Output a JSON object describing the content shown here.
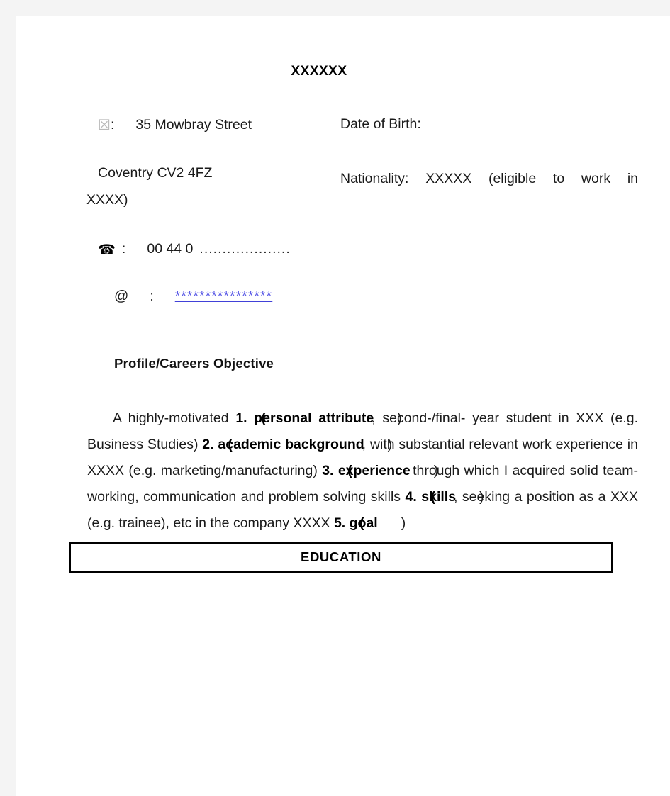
{
  "document": {
    "title": "XXXXXX",
    "page_background": "#ffffff",
    "canvas_background": "#f4f4f4"
  },
  "contact": {
    "address_icon": "envelope-icon",
    "address_icon_glyph": "☒",
    "address_separator": ":",
    "address_line1": "35 Mowbray Street",
    "address_line2": "Coventry CV2 4FZ",
    "phone_icon": "telephone-icon",
    "phone_icon_glyph": "☎",
    "phone_separator": ":",
    "phone_value": "00 44 0",
    "phone_dots": "....................",
    "email_icon": "at-icon",
    "email_icon_glyph": "@",
    "email_separator": ":",
    "email_value": "****************",
    "email_color": "#5a5ae6"
  },
  "personal": {
    "dob_label": "Date of Birth:",
    "nationality_line1": "Nationality:  XXXXX   (eligible  to  work  in",
    "nationality_line2": "XXXX)"
  },
  "profile": {
    "heading": "Profile/Careers Objective",
    "text_part1": "A highly-motivated ",
    "annotation1_open": "(",
    "annotation1": "1. personal attribute",
    "annotation1_close": ")",
    "text_part2": ", second-/final- year student in XXX (e.g. Business Studies) ",
    "annotation2_open": "(",
    "annotation2": "2. academic background",
    "annotation2_close": ")",
    "text_part3": ", with substantial relevant work experience in XXXX (e.g. marketing/manufacturing) ",
    "annotation3_open": "(",
    "annotation3": "3. experience",
    "annotation3_close": ")",
    "text_part4": " through which I acquired solid team-working, communication and problem solving skills ",
    "annotation4_open": "(",
    "annotation4": "4. skills",
    "annotation4_close": ")",
    "text_part5": ", seeking a position as a XXX (e.g. trainee), etc in the company XXXX ",
    "annotation5_open": "(",
    "annotation5": "5. goal",
    "annotation5_close": ")"
  },
  "sections": {
    "education_label": "EDUCATION"
  }
}
